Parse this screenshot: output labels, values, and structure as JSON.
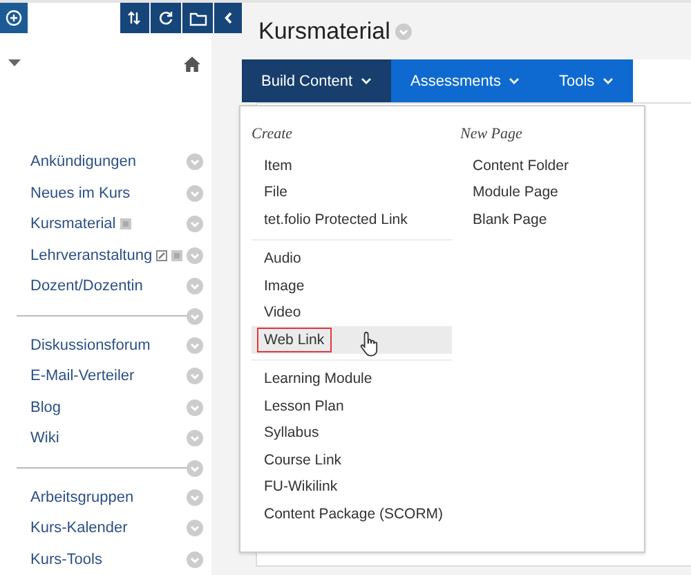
{
  "page_title": "Kursmaterial",
  "sidebar": {
    "groups": [
      {
        "items": [
          {
            "label": "Ankündigungen",
            "kind": "plain"
          },
          {
            "label": "Neues im Kurs",
            "kind": "plain"
          },
          {
            "label": "Kursmaterial",
            "kind": "marked"
          },
          {
            "label": "Lehrveranstaltung",
            "kind": "linked-marked"
          },
          {
            "label": "Dozent/Dozentin",
            "kind": "plain"
          }
        ]
      },
      {
        "items": [
          {
            "label": "Diskussionsforum",
            "kind": "plain"
          },
          {
            "label": "E-Mail-Verteiler",
            "kind": "plain"
          },
          {
            "label": "Blog",
            "kind": "plain"
          },
          {
            "label": "Wiki",
            "kind": "plain"
          }
        ]
      },
      {
        "items": [
          {
            "label": "Arbeitsgruppen",
            "kind": "plain"
          },
          {
            "label": "Kurs-Kalender",
            "kind": "plain"
          },
          {
            "label": "Kurs-Tools",
            "kind": "plain"
          }
        ]
      }
    ]
  },
  "tabs": [
    {
      "label": "Build Content",
      "selected": true
    },
    {
      "label": "Assessments",
      "selected": false
    },
    {
      "label": "Tools",
      "selected": false
    }
  ],
  "menu": {
    "create": {
      "heading": "Create",
      "groups": [
        [
          {
            "label": "Item",
            "selected": false
          },
          {
            "label": "File",
            "selected": false
          },
          {
            "label": "tet.folio Protected Link",
            "selected": false
          }
        ],
        [
          {
            "label": "Audio",
            "selected": false
          },
          {
            "label": "Image",
            "selected": false
          },
          {
            "label": "Video",
            "selected": false
          },
          {
            "label": "Web Link",
            "selected": true
          }
        ],
        [
          {
            "label": "Learning Module",
            "selected": false
          },
          {
            "label": "Lesson Plan",
            "selected": false
          },
          {
            "label": "Syllabus",
            "selected": false
          },
          {
            "label": "Course Link",
            "selected": false
          },
          {
            "label": "FU-Wikilink",
            "selected": false
          },
          {
            "label": "Content Package (SCORM)",
            "selected": false
          }
        ]
      ]
    },
    "new_page": {
      "heading": "New Page",
      "items": [
        "Content Folder",
        "Module Page",
        "Blank Page"
      ]
    }
  }
}
